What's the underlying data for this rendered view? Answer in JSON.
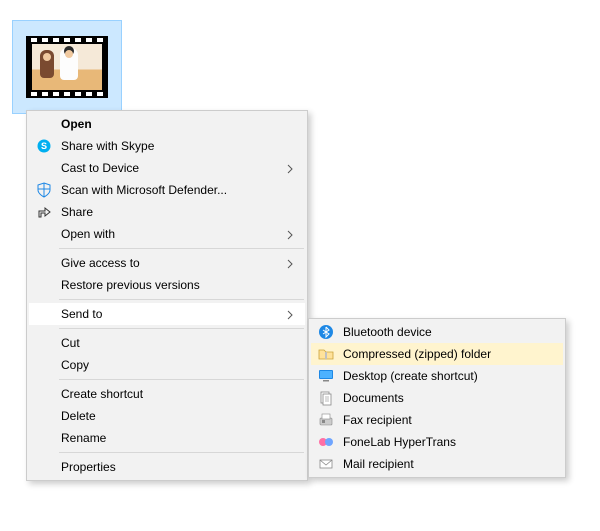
{
  "file": {
    "selected": true
  },
  "menu": {
    "open": "Open",
    "share_skype": "Share with Skype",
    "cast": "Cast to Device",
    "defender": "Scan with Microsoft Defender...",
    "share": "Share",
    "open_with": "Open with",
    "give_access": "Give access to",
    "restore": "Restore previous versions",
    "send_to": "Send to",
    "cut": "Cut",
    "copy": "Copy",
    "create_shortcut": "Create shortcut",
    "delete": "Delete",
    "rename": "Rename",
    "properties": "Properties"
  },
  "submenu": {
    "bluetooth": "Bluetooth device",
    "zip": "Compressed (zipped) folder",
    "desktop": "Desktop (create shortcut)",
    "documents": "Documents",
    "fax": "Fax recipient",
    "hypertrans": "FoneLab HyperTrans",
    "mail": "Mail recipient"
  }
}
